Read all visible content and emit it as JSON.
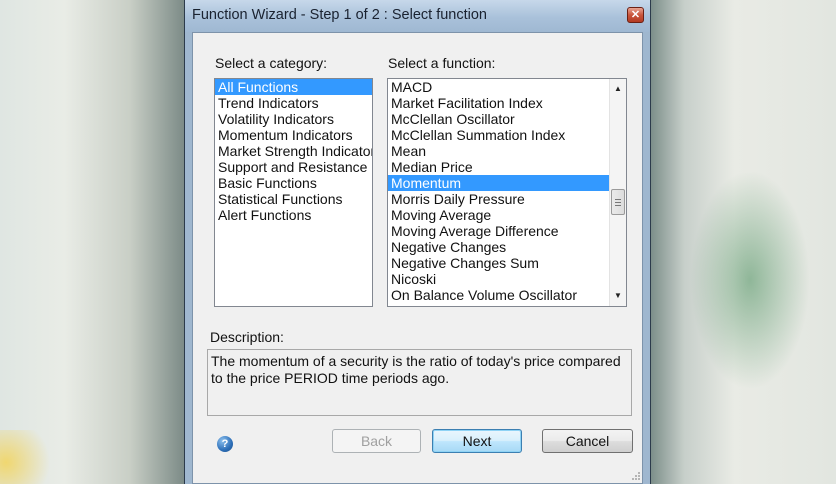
{
  "window": {
    "title": "Function Wizard - Step 1 of 2 : Select function",
    "close_glyph": "✕"
  },
  "category": {
    "label": "Select a category:",
    "items": [
      "All Functions",
      "Trend Indicators",
      "Volatility Indicators",
      "Momentum Indicators",
      "Market Strength Indicators",
      "Support and Resistance Ir",
      "Basic Functions",
      "Statistical Functions",
      "Alert Functions"
    ],
    "selected": "All Functions"
  },
  "function": {
    "label": "Select a function:",
    "items": [
      "MACD",
      "Market Facilitation Index",
      "McClellan Oscillator",
      "McClellan Summation Index",
      "Mean",
      "Median Price",
      "Momentum",
      "Morris Daily Pressure",
      "Moving Average",
      "Moving Average Difference",
      "Negative Changes",
      "Negative Changes Sum",
      "Nicoski",
      "On Balance Volume Oscillator"
    ],
    "selected": "Momentum",
    "scroll_up_glyph": "▲",
    "scroll_down_glyph": "▼"
  },
  "description": {
    "label": "Description:",
    "text": "The momentum of a security is the ratio of today's price compared to the price PERIOD time periods ago."
  },
  "buttons": {
    "back": "Back",
    "next": "Next",
    "cancel": "Cancel",
    "help_glyph": "?"
  },
  "colors": {
    "selection": "#3399ff",
    "title_bar": "#a9c1da",
    "dialog_bg": "#f0f0f0"
  }
}
